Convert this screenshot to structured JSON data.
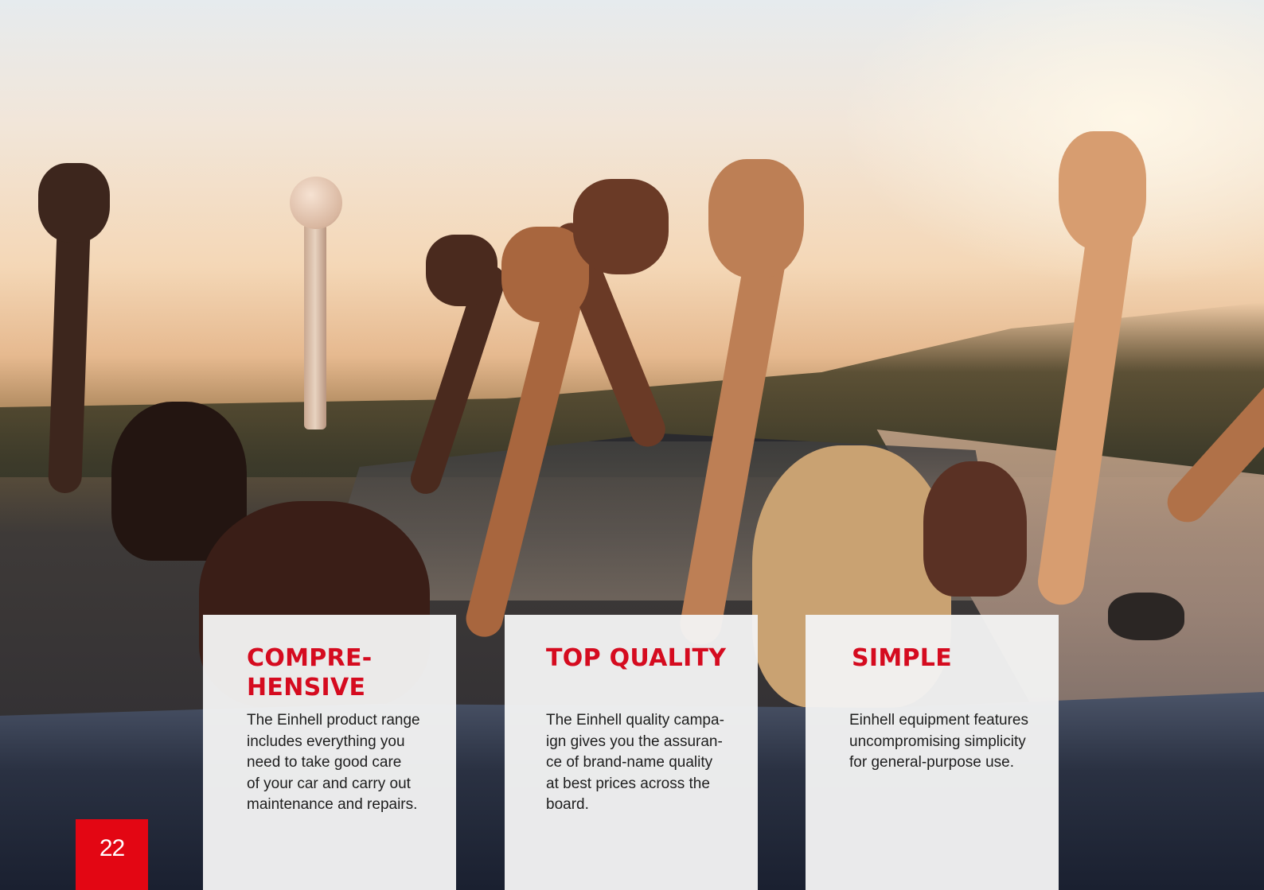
{
  "cards": [
    {
      "title": "COMPRE-\nHENSIVE",
      "body": "The Einhell product range\nincludes everything you\nneed to take good care\nof your car and carry out\nmaintenance and repairs."
    },
    {
      "title": "TOP QUALITY",
      "body": "The Einhell quality campa-\nign gives you the assuran-\nce of brand-name quality\nat best prices across the\nboard."
    },
    {
      "title": "SIMPLE",
      "body": "Einhell equipment features\nuncompromising simplicity\nfor general-purpose use."
    }
  ],
  "page_number": "22",
  "colors": {
    "accent": "#d50b1f",
    "page_box": "#e30613",
    "card_background": "#f2f2f3"
  }
}
